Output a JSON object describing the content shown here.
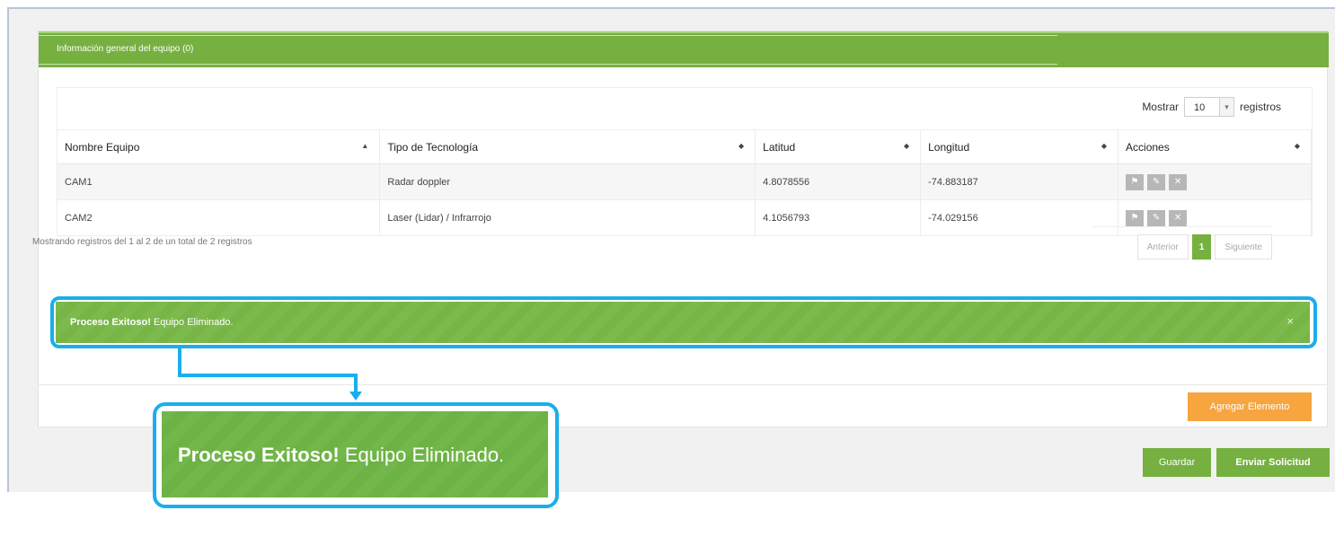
{
  "panel": {
    "title": "Información general del equipo (0)"
  },
  "length_control": {
    "prefix": "Mostrar",
    "value": "10",
    "suffix": "registros"
  },
  "table": {
    "headers": [
      "Nombre Equipo",
      "Tipo de Tecnología",
      "Latitud",
      "Longitud",
      "Acciones"
    ],
    "rows": [
      {
        "nombre": "CAM1",
        "tipo": "Radar doppler",
        "latitud": "4.8078556",
        "longitud": "-74.883187"
      },
      {
        "nombre": "CAM2",
        "tipo": "Laser (Lidar) / Infrarrojo",
        "latitud": "4.1056793",
        "longitud": "-74.029156"
      }
    ],
    "actions": [
      "flag-icon",
      "pencil-icon",
      "close-icon"
    ]
  },
  "info": "Mostrando registros del 1 al 2 de un total de 2 registros",
  "pagination": {
    "prev": "Anterior",
    "current": "1",
    "next": "Siguiente"
  },
  "alert": {
    "strong": "Proceso Exitoso!",
    "text": " Equipo Eliminado.",
    "close": "×"
  },
  "buttons": {
    "add": "Agregar Elemento",
    "save": "Guardar",
    "send": "Enviar Solicitud"
  },
  "colors": {
    "primary_green": "#76b041",
    "accent_orange": "#f6a53f",
    "callout_blue": "#1aaeec"
  }
}
